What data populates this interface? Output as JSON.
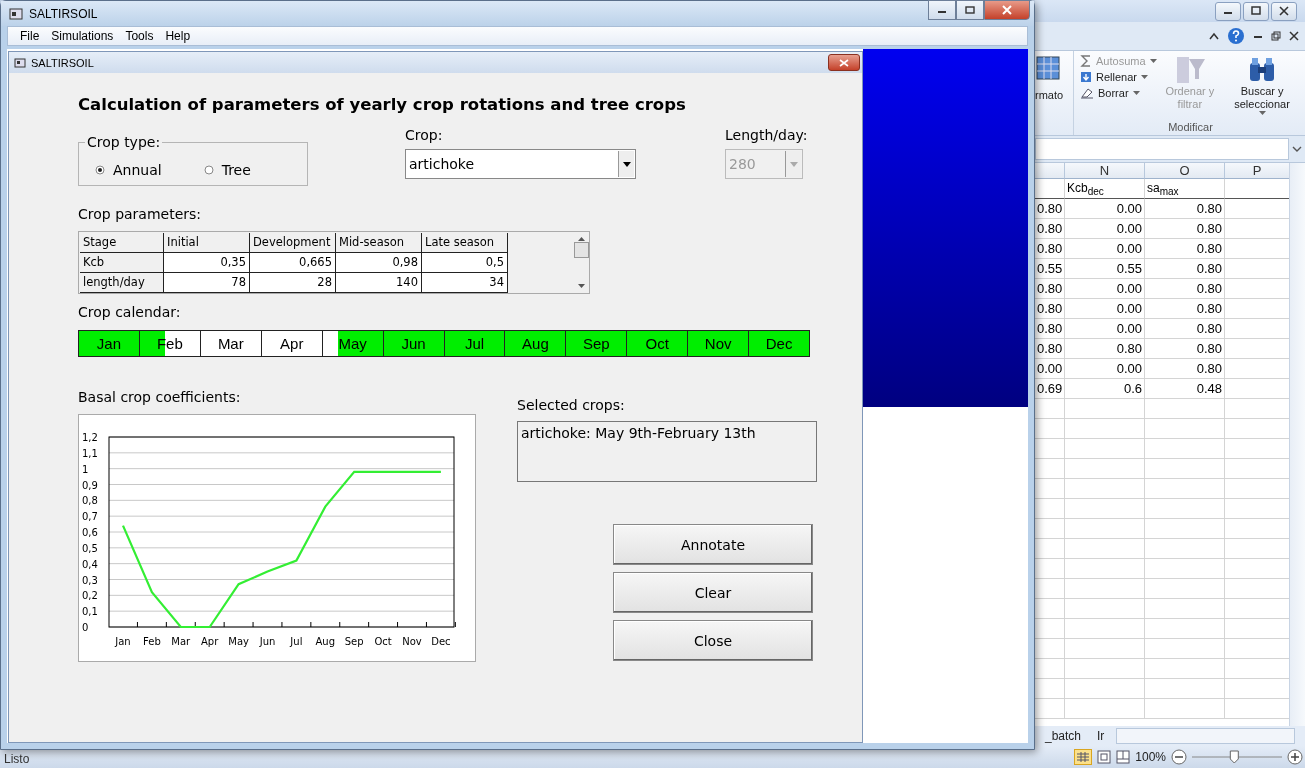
{
  "app": {
    "title": "SALTIRSOIL",
    "menu": [
      "File",
      "Simulations",
      "Tools",
      "Help"
    ]
  },
  "dialog": {
    "title": "SALTIRSOIL",
    "heading": "Calculation of parameters of yearly crop rotations and tree crops",
    "crop_type": {
      "legend": "Crop type:",
      "options": [
        {
          "label": "Annual",
          "selected": true
        },
        {
          "label": "Tree",
          "selected": false
        }
      ]
    },
    "crop": {
      "label": "Crop:",
      "value": "artichoke"
    },
    "length": {
      "label": "Length/day:",
      "value": "280",
      "disabled": true
    },
    "parameters": {
      "label": "Crop parameters:",
      "columns": [
        "Stage",
        "Initial",
        "Development",
        "Mid-season",
        "Late season"
      ],
      "rows": [
        [
          "Kcb",
          "0,35",
          "0,665",
          "0,98",
          "0,5"
        ],
        [
          "length/day",
          "78",
          "28",
          "140",
          "34"
        ]
      ]
    },
    "calendar": {
      "label": "Crop calendar:",
      "months": [
        {
          "name": "Jan",
          "level": 1,
          "kind": "start"
        },
        {
          "name": "Feb",
          "level": 0.42,
          "kind": "start"
        },
        {
          "name": "Mar"
        },
        {
          "name": "Apr"
        },
        {
          "name": "May",
          "level": 0.75,
          "kind": "end"
        },
        {
          "name": "Jun",
          "level": 1,
          "kind": "start"
        },
        {
          "name": "Jul",
          "level": 1,
          "kind": "start"
        },
        {
          "name": "Aug",
          "level": 1,
          "kind": "start"
        },
        {
          "name": "Sep",
          "level": 1,
          "kind": "start"
        },
        {
          "name": "Oct",
          "level": 1,
          "kind": "start"
        },
        {
          "name": "Nov",
          "level": 1,
          "kind": "start"
        },
        {
          "name": "Dec",
          "level": 1,
          "kind": "start"
        }
      ]
    },
    "coefficients": {
      "label": "Basal crop coefficients:",
      "chart_data": {
        "type": "line",
        "categories": [
          "Jan",
          "Feb",
          "Mar",
          "Apr",
          "May",
          "Jun",
          "Jul",
          "Aug",
          "Sep",
          "Oct",
          "Nov",
          "Dec"
        ],
        "series": [
          {
            "color": "#33ee33",
            "values": [
              0.64,
              0.22,
              0,
              0,
              0.27,
              0.35,
              0.42,
              0.76,
              0.98,
              0.98,
              0.98,
              0.98
            ]
          }
        ],
        "ylim": [
          0,
          1.2
        ],
        "grid": true,
        "yticks": [
          {
            "value": 0,
            "label": "0"
          },
          {
            "value": 0.1,
            "label": "0,1"
          },
          {
            "value": 0.2,
            "label": "0,2"
          },
          {
            "value": 0.3,
            "label": "0,3"
          },
          {
            "value": 0.4,
            "label": "0,4"
          },
          {
            "value": 0.5,
            "label": "0,5"
          },
          {
            "value": 0.6,
            "label": "0,6"
          },
          {
            "value": 0.7,
            "label": "0,7"
          },
          {
            "value": 0.8,
            "label": "0,8"
          },
          {
            "value": 0.9,
            "label": "0,9"
          },
          {
            "value": 1,
            "label": "1"
          },
          {
            "value": 1.1,
            "label": "1,1"
          },
          {
            "value": 1.2,
            "label": "1,2"
          }
        ]
      }
    },
    "selected": {
      "label": "Selected crops:",
      "text": "artichoke: May 9th-February 13th"
    },
    "buttons": [
      "Annotate",
      "Clear",
      "Close"
    ]
  },
  "excel": {
    "ribbon": {
      "partial_label": "rmato",
      "items": [
        {
          "label": "Autosuma",
          "disabled": true
        },
        {
          "label": "Rellenar",
          "disabled": false
        },
        {
          "label": "Borrar",
          "disabled": false
        }
      ],
      "sort": {
        "label": "Ordenar y filtrar",
        "disabled": true
      },
      "find": {
        "label": "Buscar y seleccionar",
        "disabled": false
      },
      "group": "Modificar"
    },
    "columns": [
      "N",
      "O",
      "P"
    ],
    "headers": [
      "Kcb$_{dec}$",
      "sa$_{max}$"
    ],
    "rows": [
      [
        "0.80",
        "0.00",
        "0.80"
      ],
      [
        "0.80",
        "0.00",
        "0.80"
      ],
      [
        "0.80",
        "0.00",
        "0.80"
      ],
      [
        "0.55",
        "0.55",
        "0.80"
      ],
      [
        "0.80",
        "0.00",
        "0.80"
      ],
      [
        "0.80",
        "0.00",
        "0.80"
      ],
      [
        "0.80",
        "0.00",
        "0.80"
      ],
      [
        "0.80",
        "0.80",
        "0.80"
      ],
      [
        "0.00",
        "0.00",
        "0.80"
      ],
      [
        "0.69",
        "0.6",
        "0.48"
      ]
    ],
    "sheet_tabs": [
      "_batch",
      "Ir"
    ],
    "status": "Listo",
    "zoom": "100%",
    "zoom_slider": {
      "level": 0.47
    }
  }
}
